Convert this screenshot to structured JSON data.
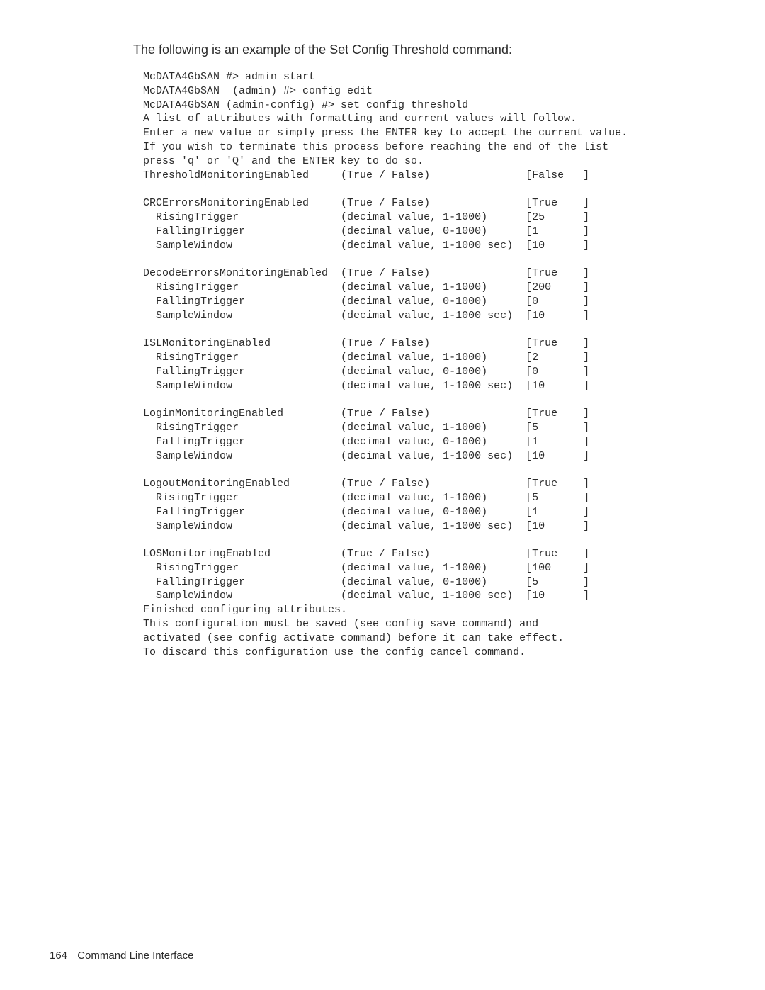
{
  "intro": "The following is an example of the Set Config Threshold command:",
  "cmds": {
    "l1": "McDATA4GbSAN #> admin start",
    "l2": "McDATA4GbSAN  (admin) #> config edit",
    "l3": "McDATA4GbSAN (admin-config) #> set config threshold",
    "l4": "A list of attributes with formatting and current values will follow.",
    "l5": "Enter a new value or simply press the ENTER key to accept the current value.",
    "l6": "If you wish to terminate this process before reaching the end of the list",
    "l7": "press 'q' or 'Q' and the ENTER key to do so."
  },
  "groups": [
    {
      "name": "ThresholdMonitoringEnabled",
      "hint": "(True / False)",
      "val": "False",
      "children": []
    },
    {
      "name": "CRCErrorsMonitoringEnabled",
      "hint": "(True / False)",
      "val": "True",
      "children": [
        {
          "name": "RisingTrigger",
          "hint": "(decimal value, 1-1000)",
          "val": "25"
        },
        {
          "name": "FallingTrigger",
          "hint": "(decimal value, 0-1000)",
          "val": "1"
        },
        {
          "name": "SampleWindow",
          "hint": "(decimal value, 1-1000 sec)",
          "val": "10"
        }
      ]
    },
    {
      "name": "DecodeErrorsMonitoringEnabled",
      "hint": "(True / False)",
      "val": "True",
      "children": [
        {
          "name": "RisingTrigger",
          "hint": "(decimal value, 1-1000)",
          "val": "200"
        },
        {
          "name": "FallingTrigger",
          "hint": "(decimal value, 0-1000)",
          "val": "0"
        },
        {
          "name": "SampleWindow",
          "hint": "(decimal value, 1-1000 sec)",
          "val": "10"
        }
      ]
    },
    {
      "name": "ISLMonitoringEnabled",
      "hint": "(True / False)",
      "val": "True",
      "children": [
        {
          "name": "RisingTrigger",
          "hint": "(decimal value, 1-1000)",
          "val": "2"
        },
        {
          "name": "FallingTrigger",
          "hint": "(decimal value, 0-1000)",
          "val": "0"
        },
        {
          "name": "SampleWindow",
          "hint": "(decimal value, 1-1000 sec)",
          "val": "10"
        }
      ]
    },
    {
      "name": "LoginMonitoringEnabled",
      "hint": "(True / False)",
      "val": "True",
      "children": [
        {
          "name": "RisingTrigger",
          "hint": "(decimal value, 1-1000)",
          "val": "5"
        },
        {
          "name": "FallingTrigger",
          "hint": "(decimal value, 0-1000)",
          "val": "1"
        },
        {
          "name": "SampleWindow",
          "hint": "(decimal value, 1-1000 sec)",
          "val": "10"
        }
      ]
    },
    {
      "name": "LogoutMonitoringEnabled",
      "hint": "(True / False)",
      "val": "True",
      "children": [
        {
          "name": "RisingTrigger",
          "hint": "(decimal value, 1-1000)",
          "val": "5"
        },
        {
          "name": "FallingTrigger",
          "hint": "(decimal value, 0-1000)",
          "val": "1"
        },
        {
          "name": "SampleWindow",
          "hint": "(decimal value, 1-1000 sec)",
          "val": "10"
        }
      ]
    },
    {
      "name": "LOSMonitoringEnabled",
      "hint": "(True / False)",
      "val": "True",
      "children": [
        {
          "name": "RisingTrigger",
          "hint": "(decimal value, 1-1000)",
          "val": "100"
        },
        {
          "name": "FallingTrigger",
          "hint": "(decimal value, 0-1000)",
          "val": "5"
        },
        {
          "name": "SampleWindow",
          "hint": "(decimal value, 1-1000 sec)",
          "val": "10"
        }
      ]
    }
  ],
  "tail": {
    "l1": "Finished configuring attributes.",
    "l2": "This configuration must be saved (see config save command) and",
    "l3": "activated (see config activate command) before it can take effect.",
    "l4": "To discard this configuration use the config cancel command."
  },
  "footer": {
    "page": "164",
    "title": "Command Line Interface"
  },
  "columns": {
    "name_indent": 0,
    "child_indent": 2,
    "hint_col": 31,
    "val_col": 60,
    "close_col": 69
  }
}
